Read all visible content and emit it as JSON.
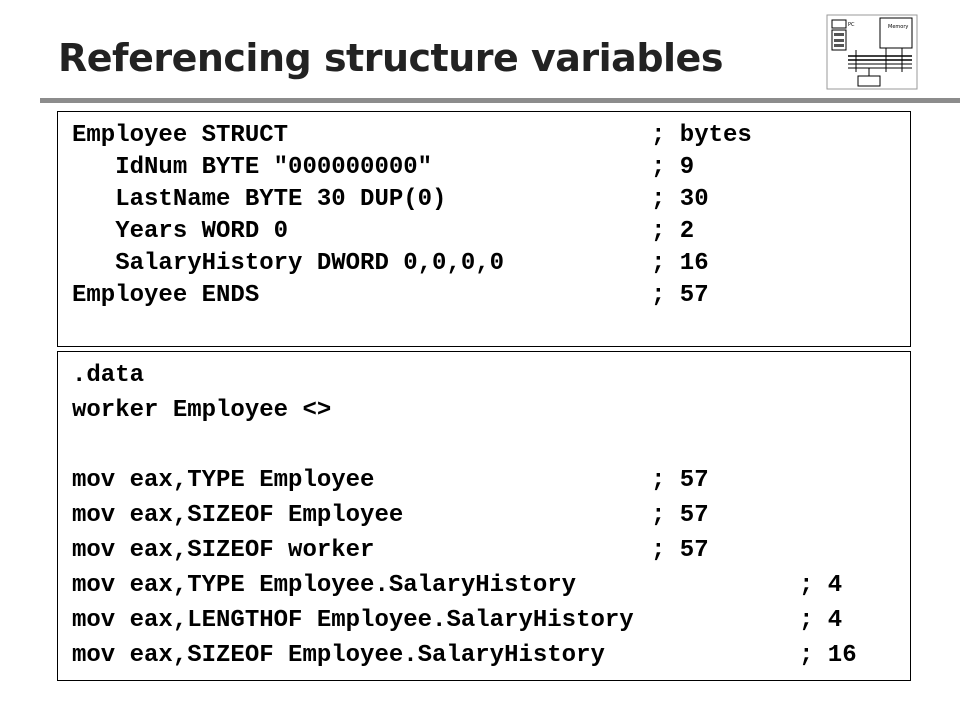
{
  "slide": {
    "title": "Referencing structure variables"
  },
  "struct_block": {
    "lines": [
      {
        "code": "Employee STRUCT",
        "comment": "; bytes"
      },
      {
        "code": "   IdNum BYTE \"000000000\"",
        "comment": "; 9"
      },
      {
        "code": "   LastName BYTE 30 DUP(0)",
        "comment": "; 30"
      },
      {
        "code": "   Years WORD 0",
        "comment": "; 2"
      },
      {
        "code": "   SalaryHistory DWORD 0,0,0,0",
        "comment": "; 16"
      },
      {
        "code": "Employee ENDS",
        "comment": "; 57"
      }
    ]
  },
  "data_block": {
    "lines": [
      {
        "code": ".data",
        "comment": ""
      },
      {
        "code": "worker Employee <>",
        "comment": ""
      },
      {
        "code": "",
        "comment": ""
      },
      {
        "code": "mov eax,TYPE Employee",
        "comment": "; 57"
      },
      {
        "code": "mov eax,SIZEOF Employee",
        "comment": "; 57"
      },
      {
        "code": "mov eax,SIZEOF worker",
        "comment": "; 57"
      },
      {
        "code": "mov eax,TYPE Employee.SalaryHistory",
        "comment": "; 4"
      },
      {
        "code": "mov eax,LENGTHOF Employee.SalaryHistory",
        "comment": "; 4"
      },
      {
        "code": "mov eax,SIZEOF Employee.SalaryHistory",
        "comment": "; 16"
      }
    ]
  }
}
